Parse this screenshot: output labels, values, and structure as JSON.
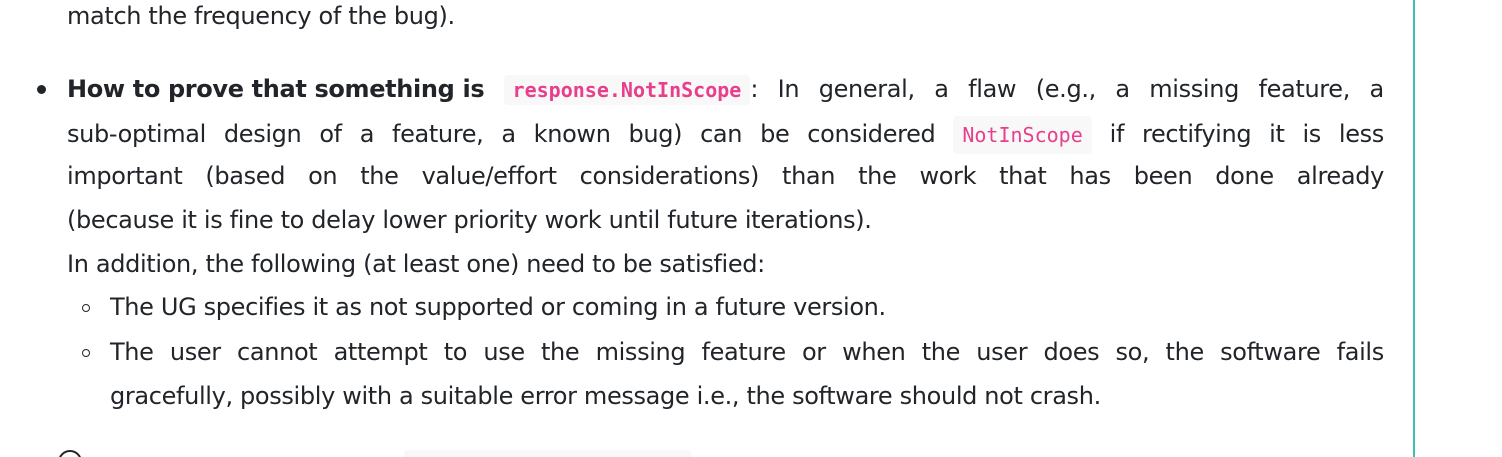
{
  "prev_item": {
    "tail_text": "match the frequency of the bug)."
  },
  "item": {
    "heading": "How to prove that something is",
    "heading_code": "response.NotInScope",
    "intro_colon": ":",
    "line1_words": [
      "In",
      "general,",
      "a",
      "flaw",
      "(e.g.,",
      "a",
      "missing",
      "feature,",
      "a"
    ],
    "line2_words": [
      "sub-optimal",
      "design",
      "of",
      "a",
      "feature,",
      "a",
      "known",
      "bug)",
      "can",
      "be",
      "considered"
    ],
    "inline_code": "NotInScope",
    "line2_after_words": [
      "if",
      "rectifying",
      "it",
      "is",
      "less"
    ],
    "line3_words": [
      "important",
      "(based",
      "on",
      "the",
      "value/effort",
      "considerations)",
      "than",
      "the",
      "work",
      "that",
      "has",
      "been",
      "done",
      "already"
    ],
    "line4": "(because it is fine to delay lower priority work until future iterations).",
    "line5": "In addition, the following (at least one) need to be satisfied:",
    "sub_items": [
      {
        "text": "The UG specifies it as not supported or coming in a future version."
      },
      {
        "line1_words": [
          "The",
          "user",
          "cannot",
          "attempt",
          "to",
          "use",
          "the",
          "missing",
          "feature",
          "or",
          "when",
          "the",
          "user",
          "does",
          "so,",
          "the",
          "software",
          "fails"
        ],
        "line2": "gracefully, possibly with a suitable error message i.e., the software should not crash."
      }
    ]
  },
  "colors": {
    "text": "#212529",
    "code": "#e83e8c",
    "code_bg": "#f8f8f8",
    "rule": "#3cbfae"
  }
}
